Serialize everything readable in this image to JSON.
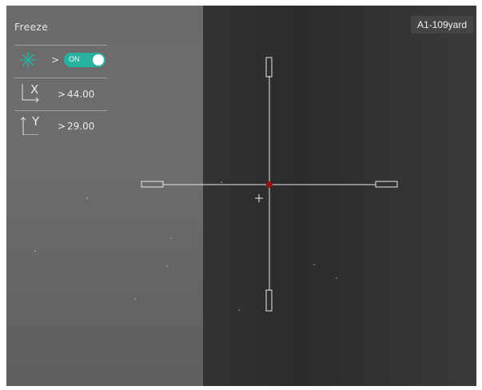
{
  "freeze_panel": {
    "title": "Freeze",
    "freeze_row": {
      "icon": "snowflake-icon",
      "arrow": ">",
      "toggle_label": "ON",
      "toggle_state": "on",
      "toggle_color": "#27b2a0"
    },
    "x_row": {
      "icon": "x-axis-icon",
      "axis": "X",
      "arrow": ">",
      "value": "44.00"
    },
    "y_row": {
      "icon": "y-axis-icon",
      "axis": "Y",
      "arrow": ">",
      "value": "29.00"
    }
  },
  "profile_badge": {
    "label": "A1-109yard"
  },
  "reticle": {
    "center_dot_color": "#9a1010",
    "line_color": "#e8e8e8"
  }
}
